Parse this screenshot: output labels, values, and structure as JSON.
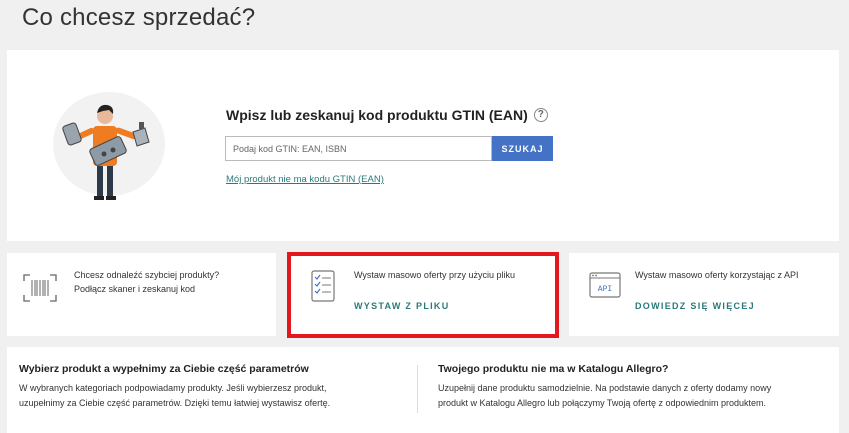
{
  "page": {
    "title": "Co chcesz sprzedać?"
  },
  "search": {
    "title": "Wpisz lub zeskanuj kod produktu GTIN (EAN)",
    "placeholder": "Podaj kod GTIN: EAN, ISBN",
    "button_label": "SZUKAJ",
    "no_gtin_link": "Mój produkt nie ma kodu GTIN (EAN)"
  },
  "options": [
    {
      "icon": "barcode-scanner-icon",
      "line1": "Chcesz odnaleźć szybciej produkty?",
      "line2": "Podłącz skaner i zeskanuj kod"
    },
    {
      "icon": "checklist-file-icon",
      "line1": "Wystaw masowo oferty przy użyciu pliku",
      "link": "WYSTAW Z PLIKU"
    },
    {
      "icon": "api-icon",
      "icon_text": "API",
      "line1": "Wystaw masowo oferty korzystając z API",
      "link": "DOWIEDZ SIĘ WIĘCEJ"
    }
  ],
  "info": {
    "left": {
      "title": "Wybierz produkt a wypełnimy za Ciebie część parametrów",
      "line1": "W wybranych kategoriach podpowiadamy produkty. Jeśli wybierzesz produkt,",
      "line2": "uzupełnimy za Ciebie część parametrów. Dzięki temu łatwiej wystawisz ofertę."
    },
    "right": {
      "title": "Twojego produktu nie ma w Katalogu Allegro?",
      "line1": "Uzupełnij dane produktu samodzielnie. Na podstawie danych z oferty dodamy nowy",
      "line2": "produkt w Katalogu Allegro lub połączymy Twoją ofertę z odpowiednim produktem."
    }
  },
  "colors": {
    "accent_blue": "#4472c4",
    "link_teal": "#2a7a7a",
    "highlight_red": "#e3181e",
    "illustration_orange": "#f07c22"
  }
}
